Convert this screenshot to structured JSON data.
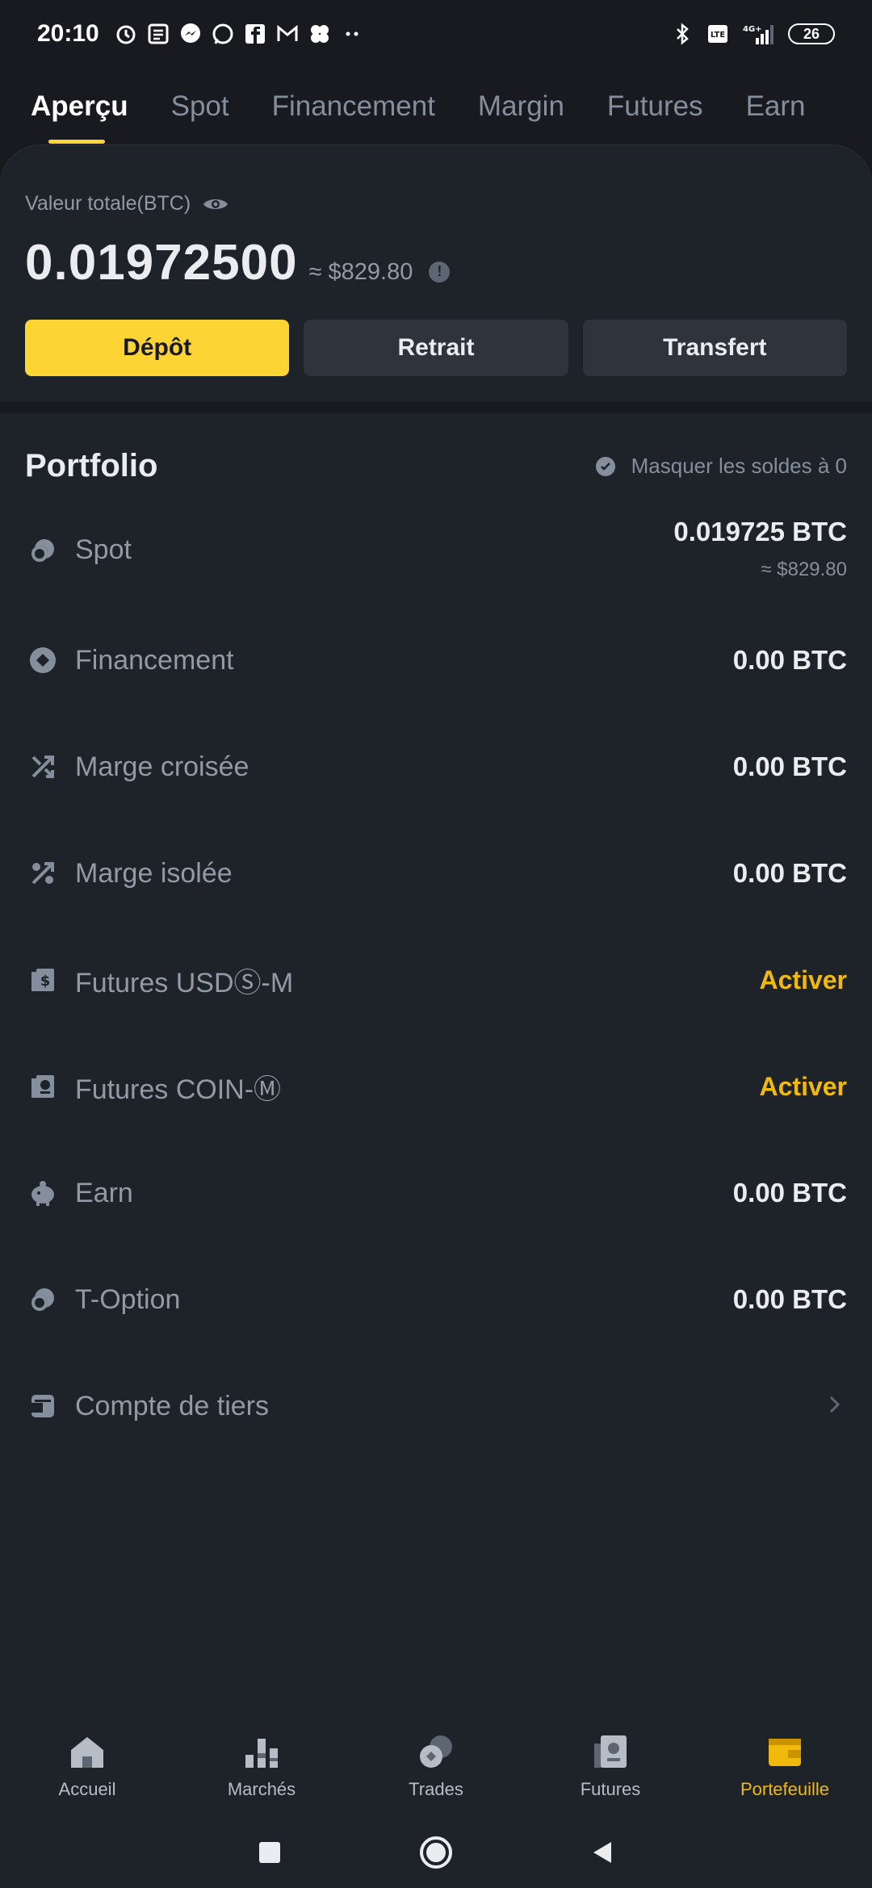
{
  "status_bar": {
    "time": "20:10",
    "battery": "26"
  },
  "top_tabs": [
    "Aperçu",
    "Spot",
    "Financement",
    "Margin",
    "Futures",
    "Earn"
  ],
  "summary": {
    "label": "Valeur totale(BTC)",
    "value": "0.01972500",
    "usd": "≈ $829.80",
    "buttons": {
      "deposit": "Dépôt",
      "withdraw": "Retrait",
      "transfer": "Transfert"
    }
  },
  "portfolio": {
    "title": "Portfolio",
    "hide_zero_label": "Masquer les soldes à 0",
    "rows": [
      {
        "name": "Spot",
        "value": "0.019725 BTC",
        "sub": "≈ $829.80",
        "icon": "spot-icon"
      },
      {
        "name": "Financement",
        "value": "0.00 BTC",
        "icon": "funding-icon"
      },
      {
        "name": "Marge croisée",
        "value": "0.00 BTC",
        "icon": "cross-margin-icon"
      },
      {
        "name": "Marge isolée",
        "value": "0.00 BTC",
        "icon": "isolated-margin-icon"
      },
      {
        "name": "Futures USDⓈ-M",
        "value": "Activer",
        "icon": "usd-futures-icon"
      },
      {
        "name": "Futures COIN-Ⓜ",
        "value": "Activer",
        "icon": "coin-futures-icon"
      },
      {
        "name": "Earn",
        "value": "0.00 BTC",
        "icon": "earn-icon"
      },
      {
        "name": "T-Option",
        "value": "0.00 BTC",
        "icon": "t-option-icon"
      },
      {
        "name": "Compte de tiers",
        "icon": "third-party-icon"
      }
    ]
  },
  "bottom_nav": [
    "Accueil",
    "Marchés",
    "Trades",
    "Futures",
    "Portefeuille"
  ],
  "colors": {
    "accent": "#fcd535",
    "activate": "#f0b90b",
    "background": "#1e2329"
  }
}
